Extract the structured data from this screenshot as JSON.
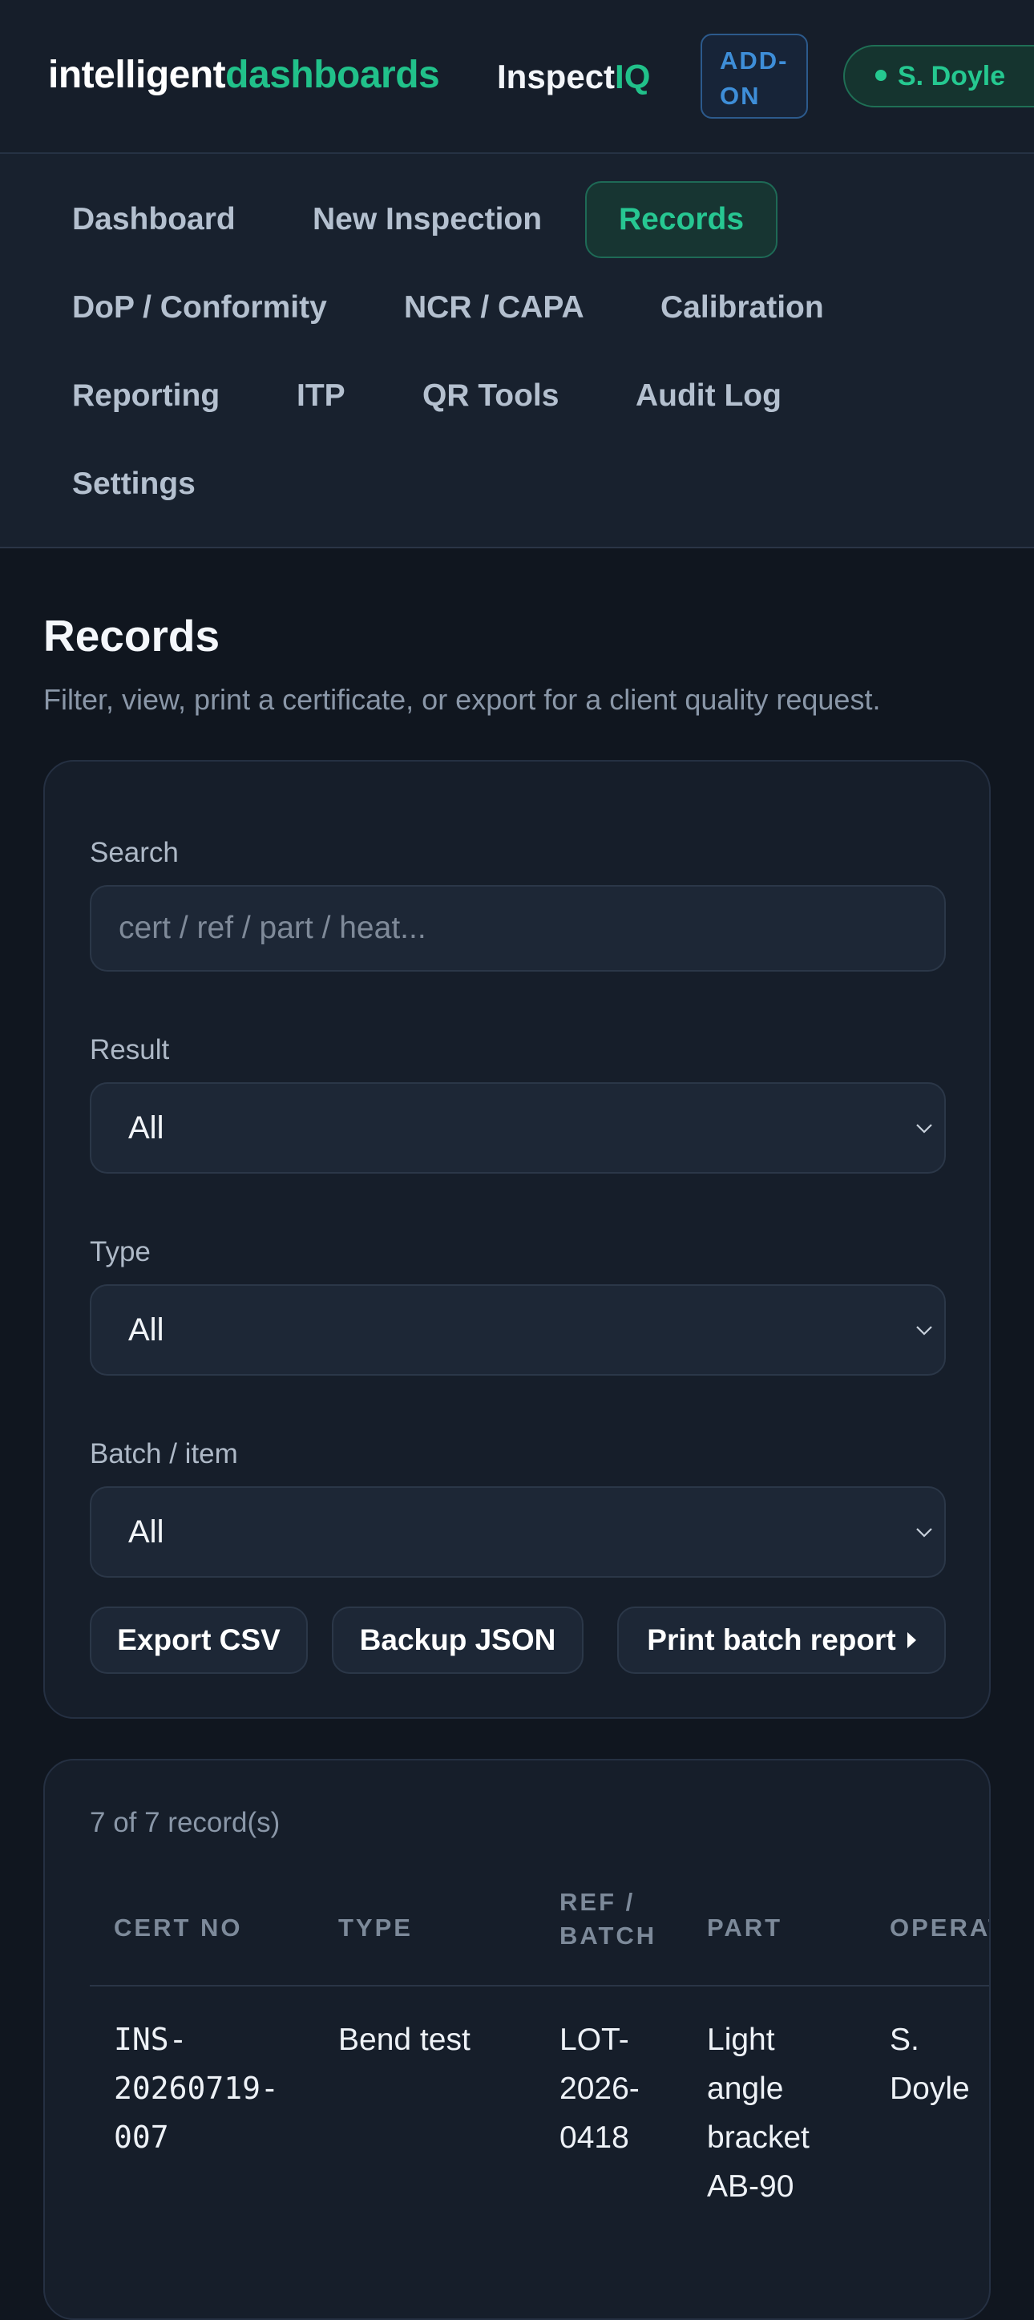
{
  "header": {
    "brand_part1": "intelligent",
    "brand_part2": "dashboards",
    "product_part1": "Inspect",
    "product_part2": "IQ",
    "addon_line1": "ADD-",
    "addon_line2": "ON",
    "user_name": "S. Doyle"
  },
  "nav": {
    "items": [
      {
        "label": "Dashboard"
      },
      {
        "label": "New Inspection"
      },
      {
        "label": "Records",
        "active": true
      },
      {
        "label": "DoP / Conformity"
      },
      {
        "label": "NCR / CAPA"
      },
      {
        "label": "Calibration"
      },
      {
        "label": "Reporting"
      },
      {
        "label": "ITP"
      },
      {
        "label": "QR Tools"
      },
      {
        "label": "Audit Log"
      },
      {
        "label": "Settings"
      }
    ]
  },
  "page": {
    "title": "Records",
    "subtitle": "Filter, view, print a certificate, or export for a client quality request."
  },
  "filters": {
    "search_label": "Search",
    "search_placeholder": "cert / ref / part / heat...",
    "search_value": "",
    "result_label": "Result",
    "result_value": "All",
    "type_label": "Type",
    "type_value": "All",
    "batch_label": "Batch / item",
    "batch_value": "All",
    "export_csv": "Export CSV",
    "backup_json": "Backup JSON",
    "print_batch": "Print batch report"
  },
  "results": {
    "count_text": "7 of 7 record(s)",
    "columns": [
      "CERT NO",
      "TYPE",
      "REF / BATCH",
      "PART",
      "OPERATOR"
    ],
    "column_lines": {
      "ref_batch": [
        "REF /",
        "BATCH"
      ]
    },
    "rows": [
      {
        "cert_no": "INS-20260719-007",
        "cert_no_lines": [
          "INS-",
          "20260719-",
          "007"
        ],
        "type": "Bend test",
        "ref_batch": "LOT-2026-0418",
        "ref_batch_lines": [
          "LOT-",
          "2026-",
          "0418"
        ],
        "part": "Light angle bracket AB-90",
        "part_lines": [
          "Light",
          "angle",
          "bracket",
          "AB-90"
        ],
        "operator": "S. Doyle"
      }
    ]
  },
  "colors": {
    "accent_green": "#21c18a",
    "addon_blue": "#3e8ed8",
    "background": "#10161f",
    "card": "#161e2a"
  }
}
